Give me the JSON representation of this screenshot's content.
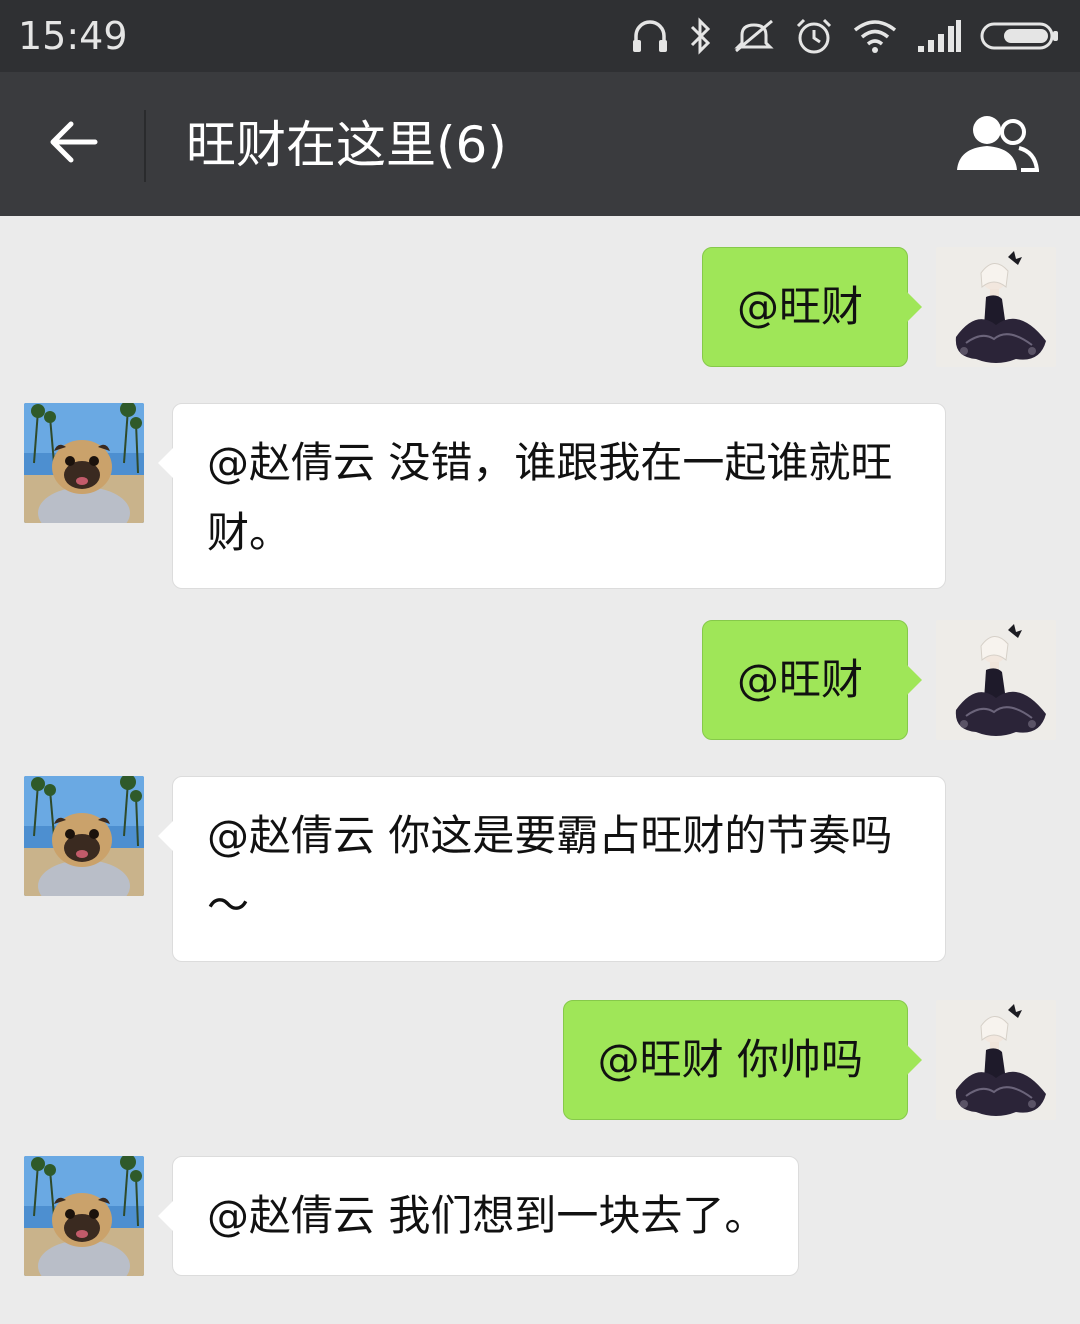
{
  "status_bar": {
    "time": "15:49",
    "icons": [
      "headphones-icon",
      "bluetooth-icon",
      "mute-icon",
      "alarm-icon",
      "wifi-icon",
      "signal-icon",
      "battery-icon"
    ]
  },
  "header": {
    "title": "旺财在这里(6)",
    "back_icon": "back-arrow-icon",
    "members_icon": "group-members-icon",
    "background": "#3a3b3e"
  },
  "colors": {
    "chat_bg": "#ebebeb",
    "outgoing_bubble": "#9fe658",
    "incoming_bubble": "#ffffff",
    "status_bar": "#2f3033"
  },
  "messages": [
    {
      "direction": "outgoing",
      "avatar": "ballerina-avatar",
      "text": "@旺财"
    },
    {
      "direction": "incoming",
      "avatar": "pug-avatar",
      "text": "@赵倩云 没错，谁跟我在一起谁就旺财。"
    },
    {
      "direction": "outgoing",
      "avatar": "ballerina-avatar",
      "text": "@旺财"
    },
    {
      "direction": "incoming",
      "avatar": "pug-avatar",
      "text": "@赵倩云 你这是要霸占旺财的节奏吗～"
    },
    {
      "direction": "outgoing",
      "avatar": "ballerina-avatar",
      "text": "@旺财 你帅吗"
    },
    {
      "direction": "incoming",
      "avatar": "pug-avatar",
      "text": "@赵倩云 我们想到一块去了。"
    }
  ]
}
